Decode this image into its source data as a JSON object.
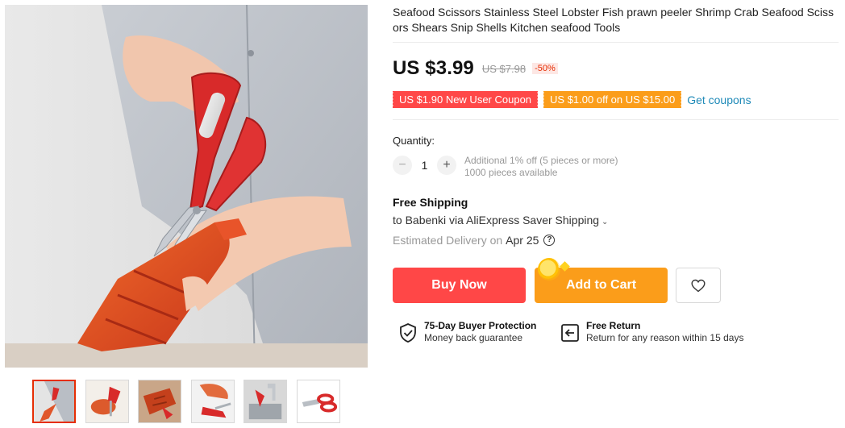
{
  "gallery": {
    "main_image": "red seafood scissors cutting lobster",
    "thumbnails": [
      {
        "name": "scissors-with-lobster",
        "active": true
      },
      {
        "name": "scissors-with-crab",
        "active": false
      },
      {
        "name": "scissors-with-crawfish",
        "active": false
      },
      {
        "name": "scissors-with-shrimp",
        "active": false
      },
      {
        "name": "scissors-at-sink",
        "active": false
      },
      {
        "name": "scissors-product-view",
        "active": false
      }
    ]
  },
  "product": {
    "title": "Seafood Scissors Stainless Steel Lobster Fish prawn peeler Shrimp Crab Seafood Scissors Shears Snip Shells Kitchen seafood Tools"
  },
  "pricing": {
    "price": "US $3.99",
    "original_price": "US $7.98",
    "discount": "-50%"
  },
  "coupons": {
    "new_user": "US $1.90 New User Coupon",
    "store": "US $1.00 off on US $15.00",
    "get_coupons": "Get coupons"
  },
  "quantity": {
    "label": "Quantity:",
    "value": "1",
    "minus": "−",
    "plus": "+",
    "note_line1": "Additional 1% off (5 pieces or more)",
    "note_line2": "1000 pieces available"
  },
  "shipping": {
    "title": "Free Shipping",
    "destination": "to Babenki via AliExpress Saver Shipping",
    "chevron": "⌄",
    "delivery_label": "Estimated Delivery on",
    "delivery_date": "Apr 25",
    "help": "?"
  },
  "actions": {
    "buy_now": "Buy Now",
    "add_to_cart": "Add to Cart",
    "wishlist_icon": "heart-icon"
  },
  "protection": {
    "buyer_title": "75-Day Buyer Protection",
    "buyer_sub": "Money back guarantee",
    "return_title": "Free Return",
    "return_sub": "Return for any reason within 15 days"
  },
  "colors": {
    "buy_now": "#ff4747",
    "add_to_cart": "#fb9d1a",
    "discount": "#e62e04",
    "link": "#1f8ab8"
  }
}
